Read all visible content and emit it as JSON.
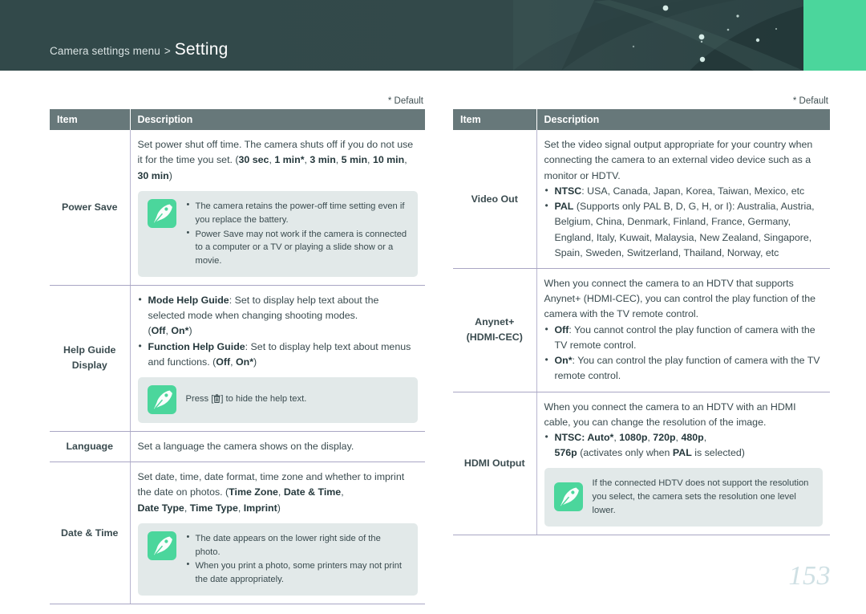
{
  "header": {
    "breadcrumb": "Camera settings menu",
    "separator": ">",
    "page_title": "Setting",
    "banner_color": "#32494a",
    "accent_color": "#4bd69c"
  },
  "default_note": "* Default",
  "table_headers": {
    "item": "Item",
    "description": "Description"
  },
  "colors": {
    "table_header_bg": "#67787a",
    "note_box_bg": "#e2e9e9",
    "icon_green": "#4bd69c",
    "row_divider": "#a9a6c4",
    "text": "#3a4b4f",
    "page_number": "#cfe0e4"
  },
  "icons": {
    "note": "feather-pen-icon",
    "delete_button": "trash-can-icon"
  },
  "left_table": {
    "rows": [
      {
        "item": "Power Save",
        "paragraphs": [
          "Set power shut off time. The camera shuts off if you do not use it for the time you set. (30 sec, 1 min*, 3 min, 5 min, 10 min, 30 min)"
        ],
        "note": {
          "bullets": [
            "The camera retains the power-off time setting even if you replace the battery.",
            "Power Save may not work if the camera is connected to a computer or a TV or playing a slide show or a movie."
          ]
        }
      },
      {
        "item": "Help Guide Display",
        "bullets": [
          "Mode Help Guide: Set to display help text about the selected mode when changing shooting modes. (Off, On*)",
          "Function Help Guide: Set to display help text about menus and functions. (Off, On*)"
        ],
        "note": {
          "text": "Press [trash] to hide the help text."
        }
      },
      {
        "item": "Language",
        "paragraphs": [
          "Set a language the camera shows on the display."
        ]
      },
      {
        "item": "Date & Time",
        "paragraphs": [
          "Set date, time, date format, time zone and whether to imprint the date on photos. (Time Zone, Date & Time, Date Type, Time Type, Imprint)"
        ],
        "note": {
          "bullets": [
            "The date appears on the lower right side of the photo.",
            "When you print a photo, some printers may not print the date appropriately."
          ]
        }
      }
    ]
  },
  "right_table": {
    "rows": [
      {
        "item": "Video Out",
        "paragraphs": [
          "Set the video signal output appropriate for your country when connecting the camera to an external video device such as a monitor or HDTV."
        ],
        "bullets": [
          "NTSC: USA, Canada, Japan, Korea, Taiwan, Mexico, etc",
          "PAL (Supports only PAL B, D, G, H, or I): Australia, Austria, Belgium, China, Denmark, Finland, France, Germany, England, Italy, Kuwait, Malaysia, New Zealand, Singapore, Spain, Sweden, Switzerland, Thailand, Norway, etc"
        ]
      },
      {
        "item": "Anynet+ (HDMI-CEC)",
        "item_line1": "Anynet+",
        "item_line2": "(HDMI-CEC)",
        "paragraphs": [
          "When you connect the camera to an HDTV that supports Anynet+ (HDMI-CEC), you can control the play function of the camera with the TV remote control."
        ],
        "bullets": [
          "Off: You cannot control the play function of camera with the TV remote control.",
          "On*: You can control the play function of camera with the TV remote control."
        ]
      },
      {
        "item": "HDMI Output",
        "paragraphs": [
          "When you connect the camera to an HDTV with an HDMI cable, you can change the resolution of the image."
        ],
        "bullets": [
          "NTSC: Auto*, 1080p, 720p, 480p, 576p (activates only when PAL is selected)"
        ],
        "note": {
          "text": "If the connected HDTV does not support the resolution you select, the camera sets the resolution one level lower."
        }
      }
    ]
  },
  "page_number": "153"
}
